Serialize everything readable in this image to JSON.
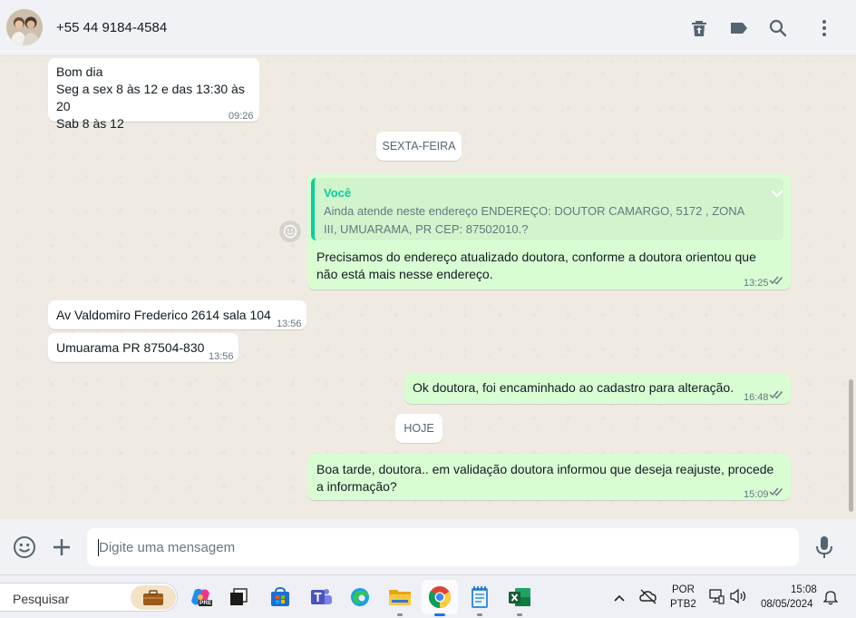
{
  "header": {
    "contact": "+55 44 9184-4584"
  },
  "messages": {
    "m1": {
      "lines": [
        "Bom dia",
        "Seg a sex 8 às 12 e das 13:30 às 20",
        "Sab 8 às 12"
      ],
      "time": "09:26"
    },
    "date1": "SEXTA-FEIRA",
    "m2": {
      "quote_author": "Você",
      "quote_text": "Ainda atende neste endereço ENDEREÇO: DOUTOR CAMARGO, 5172 , ZONA III, UMUARAMA, PR CEP: 87502010.?",
      "text_lines": [
        "Precisamos do endereço atualizado doutora, conforme a doutora orientou que",
        "não está mais nesse endereço."
      ],
      "time": "13:25"
    },
    "m3": {
      "text": "Av Valdomiro Frederico 2614 sala 104",
      "time": "13:56"
    },
    "m4": {
      "text": "Umuarama PR 87504-830",
      "time": "13:56"
    },
    "m5": {
      "text": "Ok doutora, foi encaminhado ao cadastro para alteração.",
      "time": "16:48"
    },
    "date2": "HOJE",
    "m6": {
      "text_lines": [
        "Boa tarde, doutora.. em validação doutora informou que deseja reajuste, procede",
        "a informação?"
      ],
      "time": "15:09"
    }
  },
  "composer": {
    "placeholder": "Digite uma mensagem"
  },
  "taskbar": {
    "search_label": "Pesquisar",
    "lang_top": "POR",
    "lang_bottom": "PTB2",
    "clock_time": "15:08",
    "clock_date": "08/05/2024",
    "copilot_badge": "PRE"
  },
  "colors": {
    "outgoing_bubble": "#d9fdd3",
    "incoming_bubble": "#ffffff",
    "accent": "#06cf9c",
    "read_ticks": "#667781"
  }
}
